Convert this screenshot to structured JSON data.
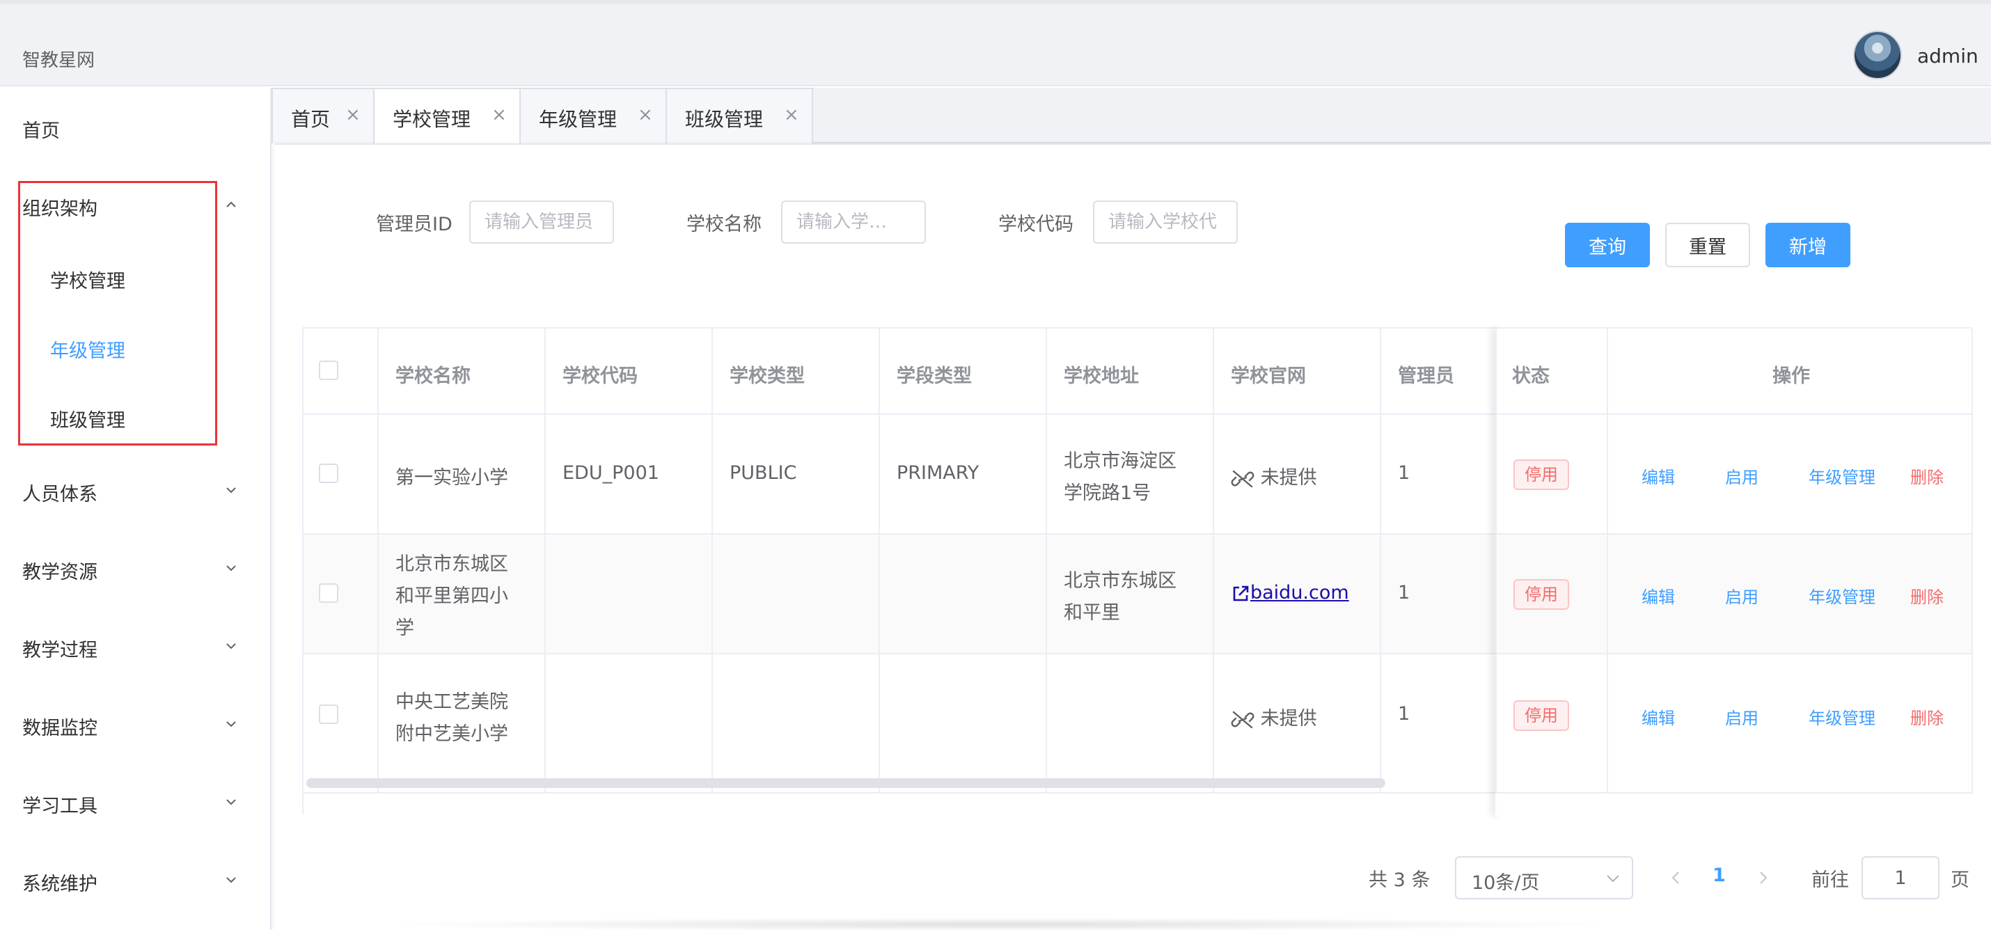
{
  "header": {
    "brand": "智教星网",
    "username": "admin"
  },
  "sidebar": {
    "items": [
      {
        "label": "首页"
      },
      {
        "label": "组织架构",
        "expanded": true,
        "children": [
          {
            "label": "学校管理"
          },
          {
            "label": "年级管理",
            "active": true
          },
          {
            "label": "班级管理"
          }
        ]
      },
      {
        "label": "人员体系"
      },
      {
        "label": "教学资源"
      },
      {
        "label": "教学过程"
      },
      {
        "label": "数据监控"
      },
      {
        "label": "学习工具"
      },
      {
        "label": "系统维护"
      }
    ]
  },
  "tabs": [
    {
      "label": "首页",
      "close": "×"
    },
    {
      "label": "学校管理",
      "close": "×",
      "active": true
    },
    {
      "label": "年级管理",
      "close": "×"
    },
    {
      "label": "班级管理",
      "close": "×"
    }
  ],
  "search": {
    "admin_id": {
      "label": "管理员ID",
      "placeholder": "请输入管理员"
    },
    "school_name": {
      "label": "学校名称",
      "placeholder": "请输入学…"
    },
    "school_code": {
      "label": "学校代码",
      "placeholder": "请输入学校代"
    }
  },
  "actions": {
    "query": "查询",
    "reset": "重置",
    "add": "新增"
  },
  "table": {
    "columns": [
      "学校名称",
      "学校代码",
      "学校类型",
      "学段类型",
      "学校地址",
      "学校官网",
      "管理员",
      "状态",
      "操作"
    ],
    "rows": [
      {
        "name": [
          "第一实验小学"
        ],
        "code": "EDU_P001",
        "type": "PUBLIC",
        "stage": "PRIMARY",
        "address": [
          "北京市海淀区",
          "学院路1号"
        ],
        "site": "未提供",
        "site_link": false,
        "admin": "1",
        "status": "停用"
      },
      {
        "name": [
          "北京市东城区",
          "和平里第四小",
          "学"
        ],
        "code": "",
        "type": "",
        "stage": "",
        "address": [
          "北京市东城区",
          "和平里"
        ],
        "site": "baidu.com",
        "site_link": true,
        "admin": "1",
        "status": "停用"
      },
      {
        "name": [
          "中央工艺美院",
          "附中艺美小学"
        ],
        "code": "",
        "type": "",
        "stage": "",
        "address": [],
        "site": "未提供",
        "site_link": false,
        "admin": "1",
        "status": "停用"
      }
    ],
    "ops": {
      "edit": "编辑",
      "enable": "启用",
      "grade": "年级管理",
      "delete": "删除"
    }
  },
  "pagination": {
    "total_text": "共 3 条",
    "page_size": "10条/页",
    "current_page": "1",
    "goto_label": "前往",
    "goto_value": "1",
    "page_suffix": "页"
  },
  "colors": {
    "primary": "#409eff",
    "danger": "#f56c6c",
    "highlight": "#e8333a"
  }
}
